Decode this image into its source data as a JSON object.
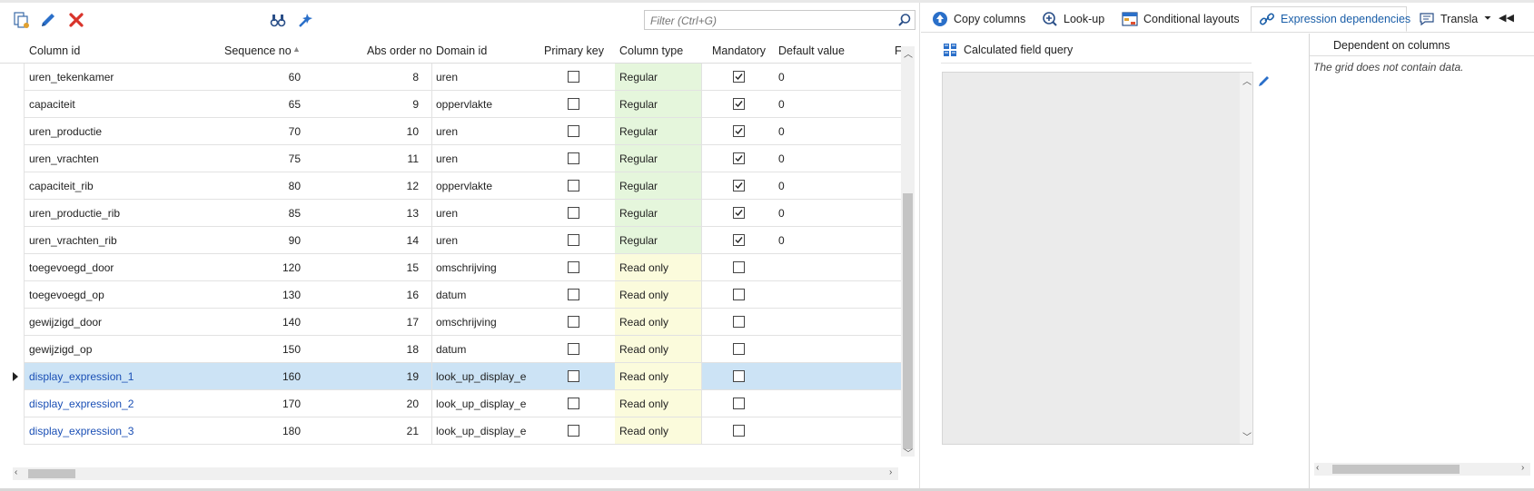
{
  "toolbar": {
    "filter_placeholder": "Filter (Ctrl+G)"
  },
  "grid": {
    "columns": [
      "Column id",
      "Sequence no",
      "Abs order no",
      "Domain id",
      "Primary key",
      "Column type",
      "Mandatory",
      "Default value",
      "Fo"
    ],
    "rows": [
      {
        "column_id": "uren_tekenkamer",
        "seq": "60",
        "abs": "8",
        "domain": "uren",
        "pk": false,
        "type": "Regular",
        "mandatory": true,
        "default": "0"
      },
      {
        "column_id": "capaciteit",
        "seq": "65",
        "abs": "9",
        "domain": "oppervlakte",
        "pk": false,
        "type": "Regular",
        "mandatory": true,
        "default": "0"
      },
      {
        "column_id": "uren_productie",
        "seq": "70",
        "abs": "10",
        "domain": "uren",
        "pk": false,
        "type": "Regular",
        "mandatory": true,
        "default": "0"
      },
      {
        "column_id": "uren_vrachten",
        "seq": "75",
        "abs": "11",
        "domain": "uren",
        "pk": false,
        "type": "Regular",
        "mandatory": true,
        "default": "0"
      },
      {
        "column_id": "capaciteit_rib",
        "seq": "80",
        "abs": "12",
        "domain": "oppervlakte",
        "pk": false,
        "type": "Regular",
        "mandatory": true,
        "default": "0"
      },
      {
        "column_id": "uren_productie_rib",
        "seq": "85",
        "abs": "13",
        "domain": "uren",
        "pk": false,
        "type": "Regular",
        "mandatory": true,
        "default": "0"
      },
      {
        "column_id": "uren_vrachten_rib",
        "seq": "90",
        "abs": "14",
        "domain": "uren",
        "pk": false,
        "type": "Regular",
        "mandatory": true,
        "default": "0"
      },
      {
        "column_id": "toegevoegd_door",
        "seq": "120",
        "abs": "15",
        "domain": "omschrijving",
        "pk": false,
        "type": "Read only",
        "mandatory": false,
        "default": ""
      },
      {
        "column_id": "toegevoegd_op",
        "seq": "130",
        "abs": "16",
        "domain": "datum",
        "pk": false,
        "type": "Read only",
        "mandatory": false,
        "default": ""
      },
      {
        "column_id": "gewijzigd_door",
        "seq": "140",
        "abs": "17",
        "domain": "omschrijving",
        "pk": false,
        "type": "Read only",
        "mandatory": false,
        "default": ""
      },
      {
        "column_id": "gewijzigd_op",
        "seq": "150",
        "abs": "18",
        "domain": "datum",
        "pk": false,
        "type": "Read only",
        "mandatory": false,
        "default": ""
      },
      {
        "column_id": "display_expression_1",
        "seq": "160",
        "abs": "19",
        "domain": "look_up_display_e",
        "pk": false,
        "type": "Read only",
        "mandatory": false,
        "default": "",
        "selected": true,
        "link": true
      },
      {
        "column_id": "display_expression_2",
        "seq": "170",
        "abs": "20",
        "domain": "look_up_display_e",
        "pk": false,
        "type": "Read only",
        "mandatory": false,
        "default": "",
        "link": true
      },
      {
        "column_id": "display_expression_3",
        "seq": "180",
        "abs": "21",
        "domain": "look_up_display_e",
        "pk": false,
        "type": "Read only",
        "mandatory": false,
        "default": "",
        "link": true
      }
    ]
  },
  "tabs": {
    "copy_columns": "Copy columns",
    "look_up": "Look-up",
    "conditional_layouts": "Conditional layouts",
    "expression_dependencies": "Expression dependencies",
    "translations": "Transla"
  },
  "calculated": {
    "title": "Calculated field query"
  },
  "dependent": {
    "header": "Dependent on columns",
    "empty": "The grid does not contain data."
  },
  "colors": {
    "accent": "#1a5ea8",
    "selected_row": "#cce3f5",
    "regular_bg": "#e5f6dc",
    "readonly_bg": "#fbfbdc",
    "delete_red": "#d9342b"
  }
}
